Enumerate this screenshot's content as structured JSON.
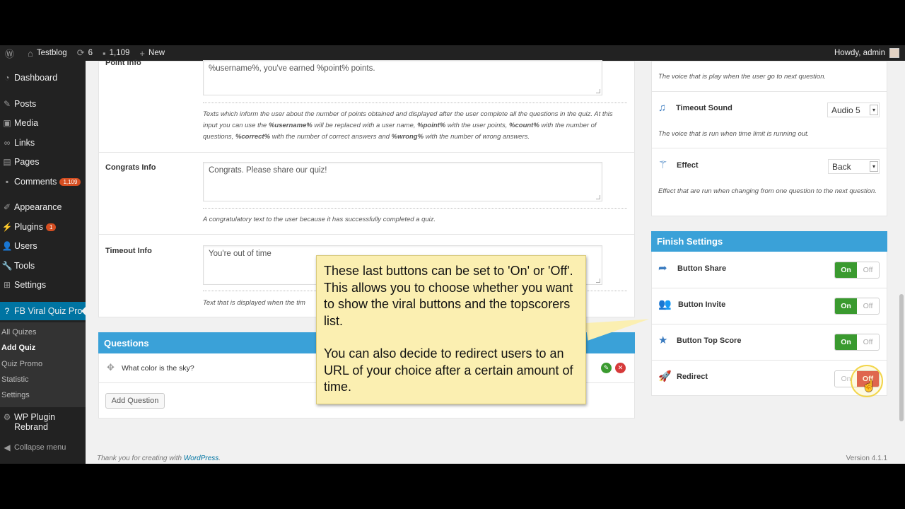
{
  "adminbar": {
    "site_name": "Testblog",
    "updates_count": "6",
    "comments_count": "1,109",
    "new_label": "New",
    "howdy": "Howdy, admin"
  },
  "sidebar": {
    "items": [
      {
        "label": "Dashboard",
        "icon": "dashboard-icon"
      },
      {
        "label": "Posts",
        "icon": "pin-icon"
      },
      {
        "label": "Media",
        "icon": "media-icon"
      },
      {
        "label": "Links",
        "icon": "link-icon"
      },
      {
        "label": "Pages",
        "icon": "page-icon"
      },
      {
        "label": "Comments",
        "icon": "comment-icon",
        "badge": "1,109"
      },
      {
        "label": "Appearance",
        "icon": "brush-icon"
      },
      {
        "label": "Plugins",
        "icon": "plug-icon",
        "badge": "1"
      },
      {
        "label": "Users",
        "icon": "user-icon"
      },
      {
        "label": "Tools",
        "icon": "wrench-icon"
      },
      {
        "label": "Settings",
        "icon": "settings-icon"
      },
      {
        "label": "FB Viral Quiz Pro",
        "icon": "question-icon"
      }
    ],
    "submenu": [
      "All Quizes",
      "Add Quiz",
      "Quiz Promo",
      "Statistic",
      "Settings"
    ],
    "wp_rebrand": "WP Plugin Rebrand",
    "collapse": "Collapse menu"
  },
  "main": {
    "point_info": {
      "label": "Point Info",
      "value": "%username%, you've earned %point% points.",
      "desc_parts": [
        "Texts which inform the user about the number of points obtained and displayed after the user complete all the questions in the quiz. At this input you can use the ",
        "%username%",
        " will be replaced with a user name, ",
        "%point%",
        " with the user points, ",
        "%count%",
        " with the number of questions, ",
        "%correct%",
        " with the number of correct answers and ",
        "%wrong%",
        " with the number of wrong answers."
      ]
    },
    "congrats_info": {
      "label": "Congrats Info",
      "value": "Congrats. Please share our quiz!",
      "desc": "A congratulatory text to the user because it has successfully completed a quiz."
    },
    "timeout_info": {
      "label": "Timeout Info",
      "value": "You're out of time",
      "desc": "Text that is displayed when the tim"
    },
    "questions": {
      "title": "Questions",
      "items": [
        {
          "text": "What color is the sky?"
        }
      ],
      "add_label": "Add Question"
    }
  },
  "right": {
    "next_question_desc": "The voice that is play when the user go to next question.",
    "timeout_sound": {
      "label": "Timeout Sound",
      "value": "Audio 5",
      "desc": "The voice that is run when time limit is running out."
    },
    "effect": {
      "label": "Effect",
      "value": "Back",
      "desc": "Effect that are run when changing from one question to the next question."
    },
    "finish_settings": {
      "title": "Finish Settings",
      "on_label": "On",
      "off_label": "Off",
      "items": [
        {
          "label": "Button Share",
          "state": "On"
        },
        {
          "label": "Button Invite",
          "state": "On"
        },
        {
          "label": "Button Top Score",
          "state": "On"
        },
        {
          "label": "Redirect",
          "state": "Off"
        }
      ]
    }
  },
  "callout": {
    "para1": "These last buttons can be set to 'On' or 'Off'. This allows you to choose whether you want to show the viral buttons and the topscorers list.",
    "para2": "You can also decide to redirect users to an URL of your choice after a certain amount of time."
  },
  "footer": {
    "thanks_prefix": "Thank you for creating with ",
    "thanks_link": "WordPress",
    "thanks_suffix": ".",
    "version": "Version 4.1.1"
  },
  "colors": {
    "accent": "#3aa1d8",
    "on": "#3a9a2f",
    "off": "#d63a3a",
    "callout": "#fbefb1"
  }
}
